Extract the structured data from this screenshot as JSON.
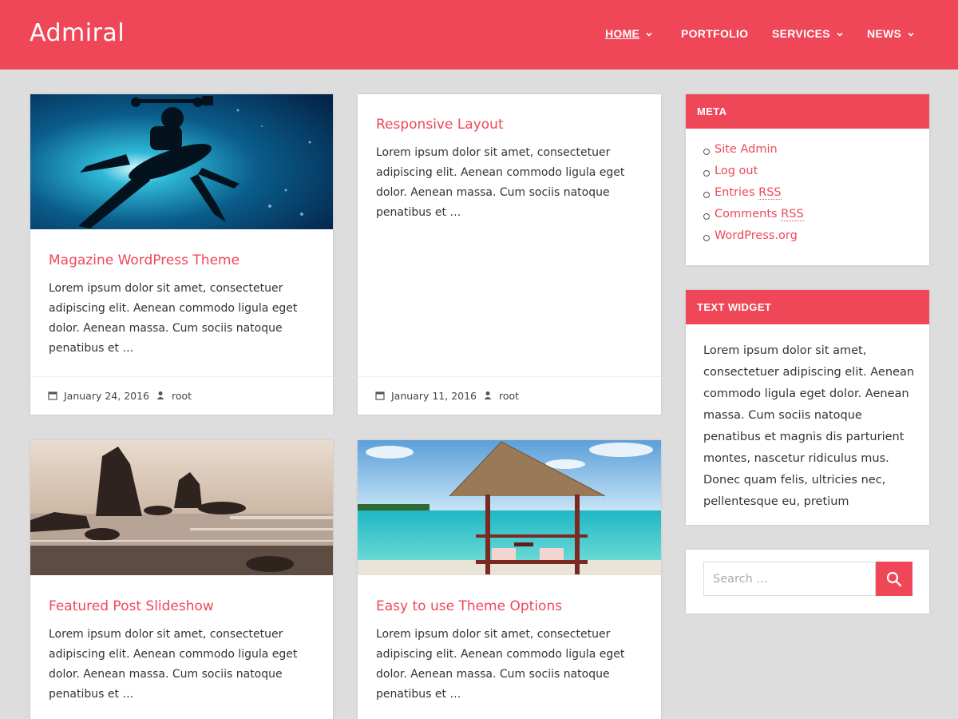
{
  "site": {
    "title": "Admiral"
  },
  "nav": {
    "items": [
      {
        "label": "HOME",
        "active": true,
        "has_dropdown": true
      },
      {
        "label": "PORTFOLIO",
        "active": false,
        "has_dropdown": false
      },
      {
        "label": "SERVICES",
        "active": false,
        "has_dropdown": true
      },
      {
        "label": "NEWS",
        "active": false,
        "has_dropdown": true
      }
    ]
  },
  "posts": [
    {
      "title": "Magazine WordPress Theme",
      "excerpt": "Lorem ipsum dolor sit amet, consectetuer adipiscing elit. Aenean commodo ligula eget dolor. Aenean massa. Cum sociis natoque penatibus et …",
      "date": "January 24, 2016",
      "author": "root",
      "image": "scuba-diver-underwater"
    },
    {
      "title": "Responsive Layout",
      "excerpt": "Lorem ipsum dolor sit amet, consectetuer adipiscing elit. Aenean commodo ligula eget dolor. Aenean massa. Cum sociis natoque penatibus et …",
      "date": "January 11, 2016",
      "author": "root",
      "image": ""
    },
    {
      "title": "Featured Post Slideshow",
      "excerpt": "Lorem ipsum dolor sit amet, consectetuer adipiscing elit. Aenean commodo ligula eget dolor. Aenean massa. Cum sociis natoque penatibus et …",
      "image": "rocky-coastline-sunset"
    },
    {
      "title": "Easy to use Theme Options",
      "excerpt": "Lorem ipsum dolor sit amet, consectetuer adipiscing elit. Aenean commodo ligula eget dolor. Aenean massa. Cum sociis natoque penatibus et …",
      "image": "beach-hut-tropical-sea"
    }
  ],
  "sidebar": {
    "meta": {
      "heading": "META",
      "links": [
        {
          "text": "Site Admin"
        },
        {
          "text": "Log out"
        },
        {
          "prefix": "Entries ",
          "abbr": "RSS"
        },
        {
          "prefix": "Comments ",
          "abbr": "RSS"
        },
        {
          "text": "WordPress.org"
        }
      ]
    },
    "text_widget": {
      "heading": "TEXT WIDGET",
      "body": "Lorem ipsum dolor sit amet, consectetuer adipiscing elit. Aenean commodo ligula eget dolor. Aenean massa. Cum sociis natoque penatibus et magnis dis parturient montes, nascetur ridiculus mus. Donec quam felis, ultricies nec, pellentesque eu, pretium"
    },
    "search": {
      "placeholder": "Search …",
      "icon": "search-icon"
    }
  },
  "colors": {
    "accent": "#ef4758",
    "background": "#dddddd",
    "text": "#333333"
  }
}
